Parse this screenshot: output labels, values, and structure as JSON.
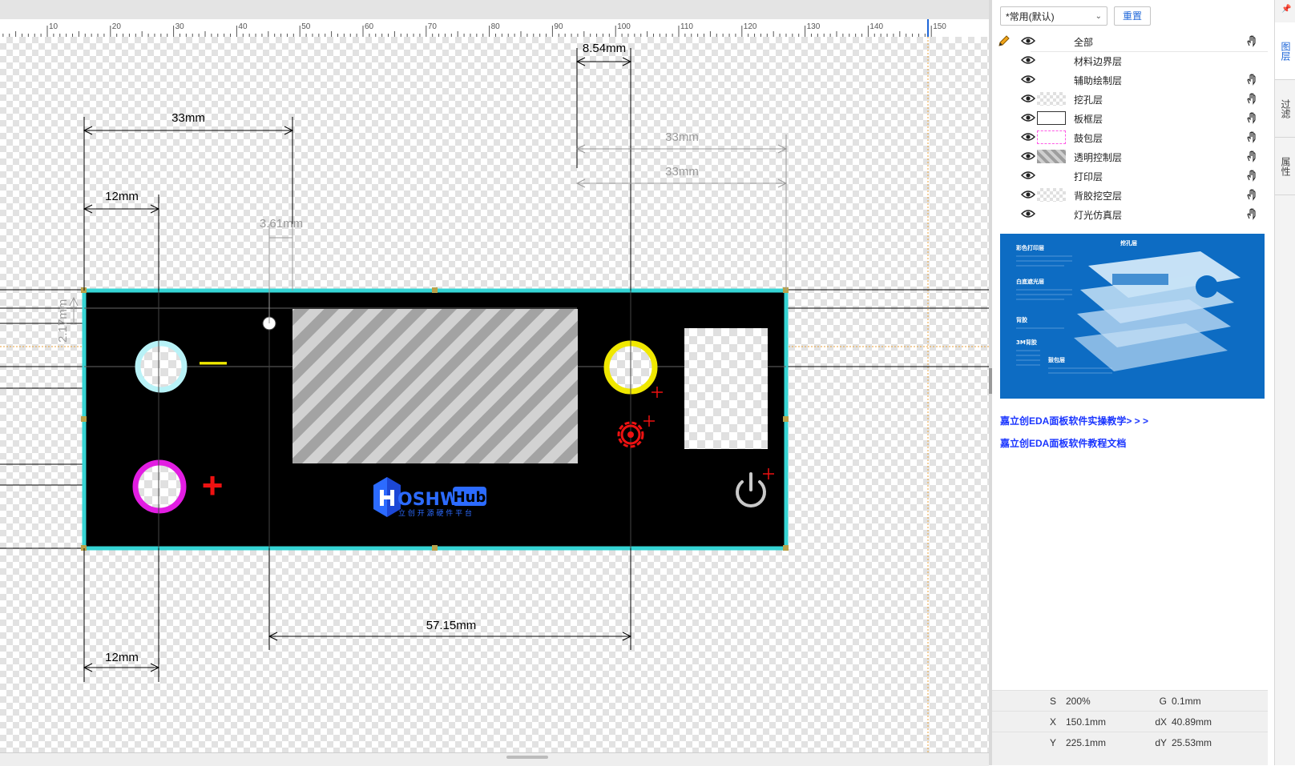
{
  "ruler": {
    "labels": [
      "10",
      "20",
      "30",
      "40",
      "50",
      "60",
      "70",
      "80",
      "90",
      "100",
      "110",
      "120",
      "130",
      "140",
      "150"
    ]
  },
  "dimensions": {
    "d33_left": "33mm",
    "d12_top": "12mm",
    "d361": "3.61mm",
    "d217": "2.17mm",
    "d854": "8.54mm",
    "d33_right_a": "33mm",
    "d33_right_b": "33mm",
    "d5715": "57.15mm",
    "d12_bottom": "12mm"
  },
  "panel_board": {
    "minus_symbol": "—",
    "plus_symbol": "+",
    "logo_text": "OSHW",
    "logo_badge": "Hub",
    "logo_subtitle": "立 创 开 源 硬 件 平 台"
  },
  "layers_panel": {
    "preset": "*常用(默认)",
    "reset_label": "重置",
    "all_label": "全部",
    "layers": [
      {
        "label": "材料边界层",
        "swatch": "none",
        "hand": false
      },
      {
        "label": "辅助绘制层",
        "swatch": "none",
        "hand": true
      },
      {
        "label": "挖孔层",
        "swatch": "checker",
        "hand": true
      },
      {
        "label": "板框层",
        "swatch": "outline",
        "hand": true
      },
      {
        "label": "鼓包层",
        "swatch": "dashed-pink",
        "hand": true
      },
      {
        "label": "透明控制层",
        "swatch": "hatched",
        "hand": true
      },
      {
        "label": "打印层",
        "swatch": "none",
        "hand": true
      },
      {
        "label": "背胶挖空层",
        "swatch": "checker",
        "hand": true
      },
      {
        "label": "灯光仿真层",
        "swatch": "none",
        "hand": true
      }
    ],
    "info_image": {
      "title": "挖孔层",
      "labels": [
        "彩色打印层",
        "白底遮光层",
        "鼓包层",
        "背胶",
        "3M背胶"
      ]
    },
    "links": [
      "嘉立创EDA面板软件实操教学> > >",
      "嘉立创EDA面板软件教程文档"
    ]
  },
  "status_bar": {
    "S_key": "S",
    "S_val": "200%",
    "G_key": "G",
    "G_val": "0.1mm",
    "X_key": "X",
    "X_val": "150.1mm",
    "dX_key": "dX",
    "dX_val": "40.89mm",
    "Y_key": "Y",
    "Y_val": "225.1mm",
    "dY_key": "dY",
    "dY_val": "25.53mm"
  },
  "side_tabs": [
    "图层",
    "过滤",
    "属性"
  ],
  "colors": {
    "board_outline": "#35d4d4",
    "board_fill": "#000000",
    "dimension_line": "#000000",
    "dimension_line_alt": "#9a9a9a",
    "hole_cyan": "#b8f2f7",
    "hole_magenta": "#e21de2",
    "hole_yellow": "#f0e800",
    "mark_red": "#ee1111",
    "link_blue": "#1a35ff",
    "accent_blue": "#1e66d8"
  }
}
